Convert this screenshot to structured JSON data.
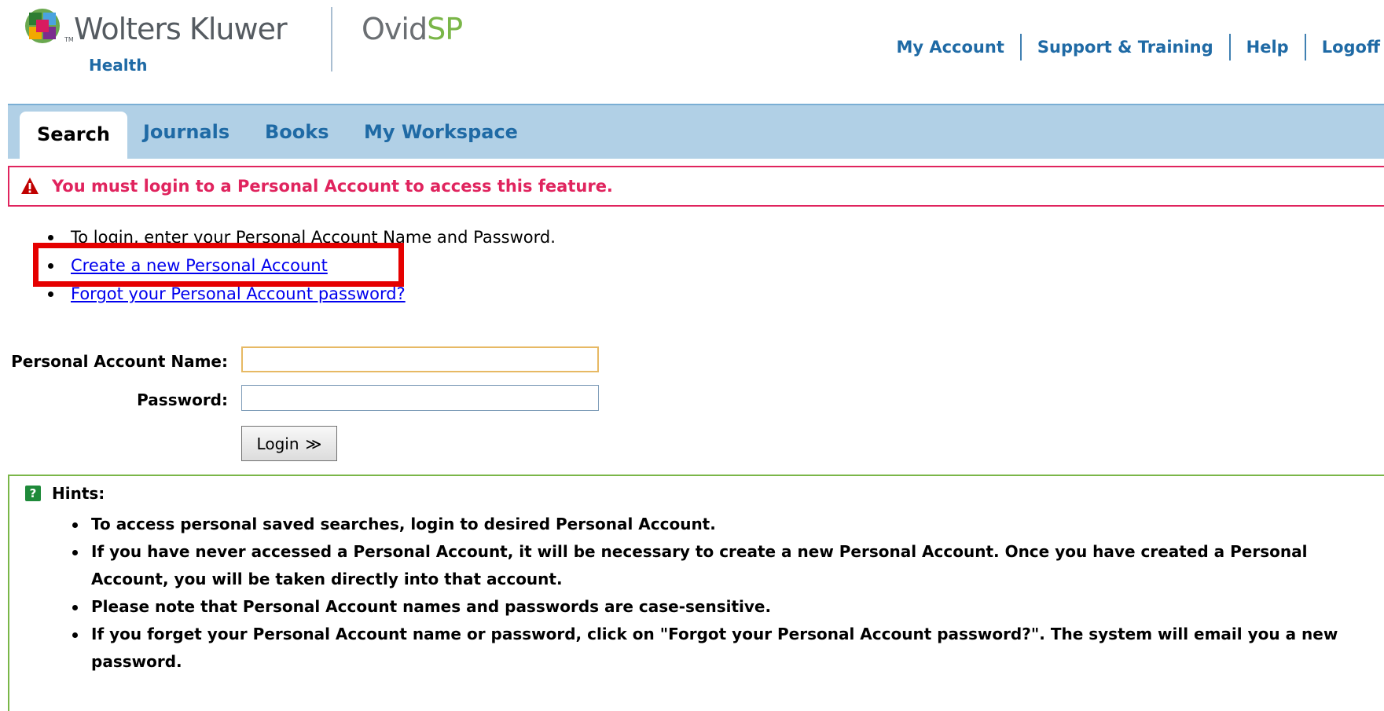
{
  "header": {
    "brand": "Wolters Kluwer",
    "tm": "TM",
    "sub_brand": "Health",
    "product_part1": "Ovid",
    "product_part2": "SP",
    "links": {
      "my_account": "My Account",
      "support": "Support & Training",
      "help": "Help",
      "logoff": "Logoff"
    }
  },
  "tabs": {
    "search": "Search",
    "journals": "Journals",
    "books": "Books",
    "workspace": "My Workspace"
  },
  "alert": {
    "message": "You must login to a Personal Account to access this feature.",
    "icon": "warning-icon",
    "color": "#e0245e"
  },
  "info": {
    "instruction": "To login, enter your Personal Account Name and Password.",
    "create_link": "Create a new Personal Account",
    "forgot_link": "Forgot your Personal Account password?"
  },
  "form": {
    "name_label": "Personal Account Name:",
    "name_value": "",
    "password_label": "Password:",
    "password_value": "",
    "login_label": "Login",
    "login_arrow": "≫"
  },
  "hints": {
    "icon": "?",
    "title": "Hints:",
    "items": [
      "To access personal saved searches, login to desired Personal Account.",
      "If you have never accessed a Personal Account, it will be necessary to create a new Personal Account. Once you have created a Personal Account, you will be taken directly into that account.",
      "Please note that Personal Account names and passwords are case-sensitive.",
      "If you forget your Personal Account name or password, click on \"Forgot your Personal Account password?\". The system will email you a new password."
    ]
  },
  "colors": {
    "link_blue": "#1f6aa5",
    "tab_bar": "#b1d0e6",
    "highlight": "#e50000",
    "hint_border": "#7ab648"
  }
}
